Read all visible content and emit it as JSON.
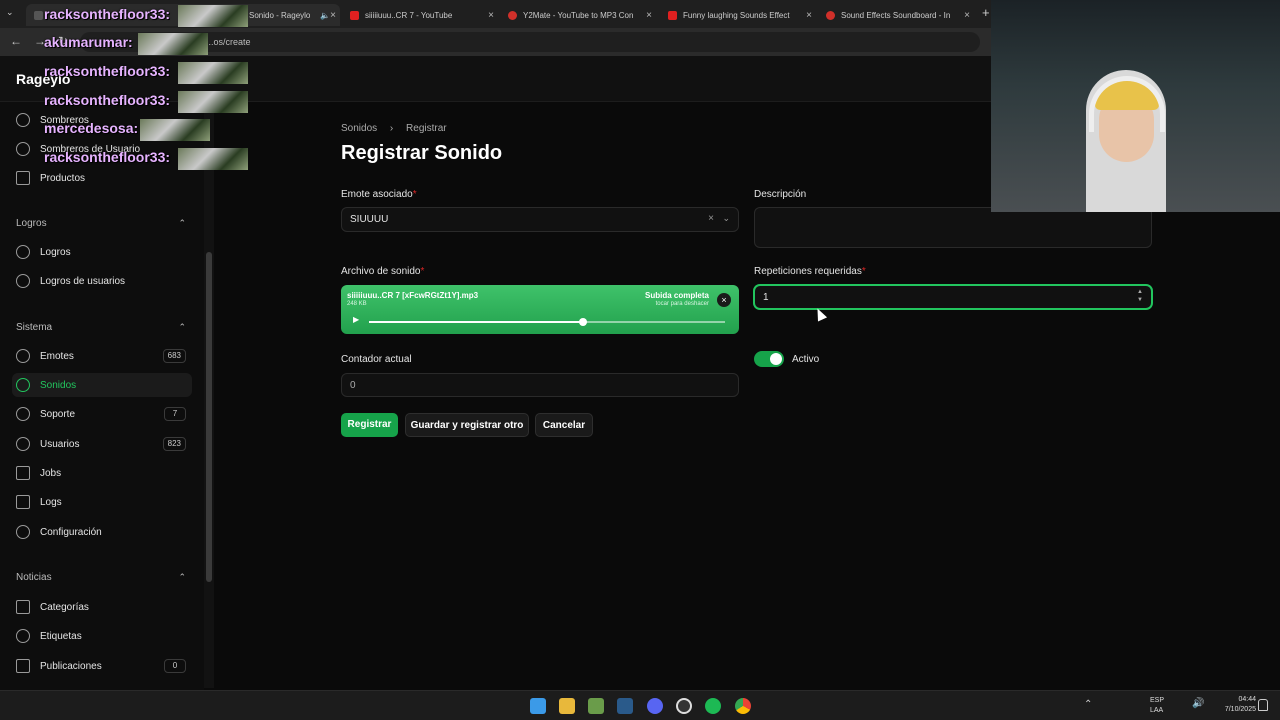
{
  "browser": {
    "tabs": [
      {
        "label": "Sonido - Rageylo",
        "active": true
      },
      {
        "label": "siiiiiuuu..CR 7 - YouTube"
      },
      {
        "label": "Y2Mate - YouTube to MP3 Con"
      },
      {
        "label": "Funny laughing Sounds Effect"
      },
      {
        "label": "Sound Effects Soundboard - In"
      }
    ],
    "url": "...os/create"
  },
  "app": {
    "brand": "Rageylo"
  },
  "sidebar": {
    "top_items": [
      {
        "label": "Sombreros"
      },
      {
        "label": "Sombreros de Usuario"
      },
      {
        "label": "Productos"
      }
    ],
    "groups": [
      {
        "title": "Logros",
        "items": [
          {
            "label": "Logros"
          },
          {
            "label": "Logros de usuarios"
          }
        ]
      },
      {
        "title": "Sistema",
        "items": [
          {
            "label": "Emotes",
            "badge": "683"
          },
          {
            "label": "Sonidos",
            "active": true
          },
          {
            "label": "Soporte",
            "badge": "7"
          },
          {
            "label": "Usuarios",
            "badge": "823"
          },
          {
            "label": "Jobs"
          },
          {
            "label": "Logs"
          },
          {
            "label": "Configuración"
          }
        ]
      },
      {
        "title": "Noticias",
        "items": [
          {
            "label": "Categorías"
          },
          {
            "label": "Etiquetas"
          },
          {
            "label": "Publicaciones",
            "badge": "0"
          }
        ]
      }
    ]
  },
  "page": {
    "breadcrumb": [
      "Sonidos",
      "Registrar"
    ],
    "title": "Registrar Sonido",
    "form": {
      "emote_label": "Emote asociado",
      "emote_value": "SIUUUU",
      "descripcion_label": "Descripción",
      "descripcion_value": "",
      "archivo_label": "Archivo de sonido",
      "file_name": "siiiiiuuu..CR 7 [xFcwRGtZt1Y].mp3",
      "file_size": "248 KB",
      "upload_status": "Subida completa",
      "upload_hint": "tocar para deshacer",
      "audio_progress": 0.6,
      "repeticiones_label": "Repeticiones requeridas",
      "repeticiones_value": "1",
      "contador_label": "Contador actual",
      "contador_value": "0",
      "activo_label": "Activo",
      "activo_on": true
    },
    "buttons": {
      "registrar": "Registrar",
      "guardar_otro": "Guardar y registrar otro",
      "cancelar": "Cancelar"
    }
  },
  "chat_overlay": [
    {
      "user": "akumarumar:"
    },
    {
      "user": "racksonthefloor33:"
    },
    {
      "user": "racksonthefloor33:"
    },
    {
      "user": "racksonthefloor33:"
    },
    {
      "user": "mercedesosa:"
    },
    {
      "user": "racksonthefloor33:"
    }
  ],
  "taskbar": {
    "lang": "ESP",
    "lang2": "LAA",
    "time": "04:44",
    "date": "7/10/2025"
  },
  "colors": {
    "accent": "#16a34a",
    "upload_green": "#22c55e",
    "required": "#dc2626"
  }
}
